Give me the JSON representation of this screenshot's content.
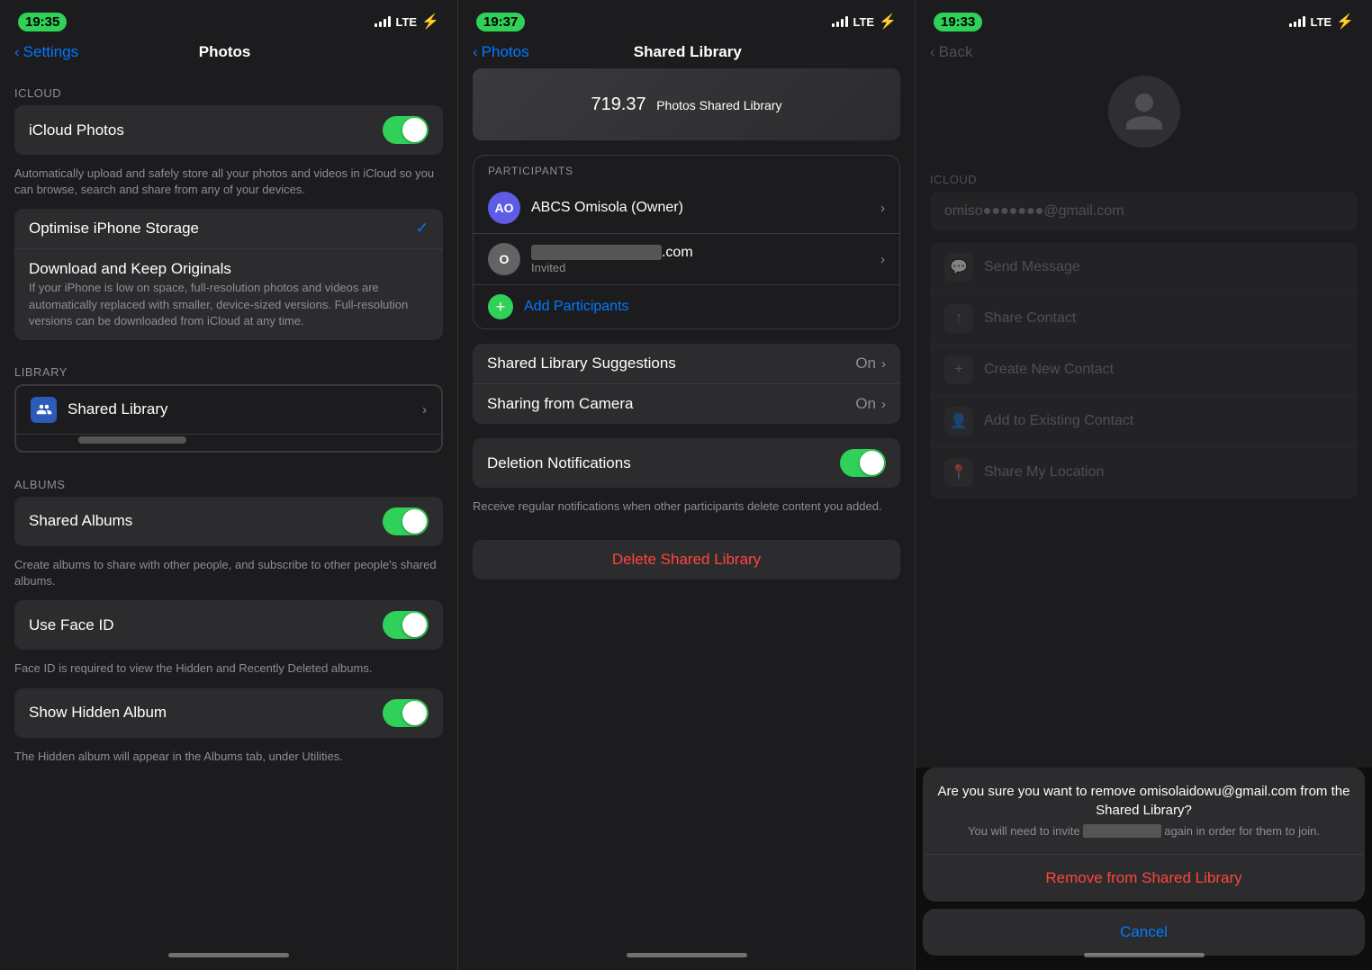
{
  "colors": {
    "green": "#30d158",
    "blue": "#007aff",
    "red": "#ff453a",
    "bg": "#1c1c1e",
    "card": "#2c2c2e",
    "separator": "#3a3a3c",
    "textPrimary": "#ffffff",
    "textSecondary": "#8e8e93"
  },
  "screen1": {
    "statusTime": "19:35",
    "navBack": "Settings",
    "navTitle": "Photos",
    "sections": {
      "icloud": {
        "header": "iCloud",
        "items": [
          {
            "label": "iCloud Photos",
            "toggle": true,
            "desc": "Automatically upload and safely store all your photos and videos in iCloud so you can browse, search and share from any of your devices."
          }
        ]
      },
      "storage": {
        "items": [
          {
            "label": "Optimise iPhone Storage",
            "checkmark": true
          },
          {
            "label": "Download and Keep Originals",
            "desc": "If your iPhone is low on space, full-resolution photos and videos are automatically replaced with smaller, device-sized versions. Full-resolution versions can be downloaded from iCloud at any time."
          }
        ]
      },
      "library": {
        "header": "Library",
        "items": [
          {
            "label": "Shared Library",
            "icon": "people",
            "highlighted": true,
            "chevron": true
          }
        ]
      },
      "albums": {
        "header": "Albums",
        "items": [
          {
            "label": "Shared Albums",
            "toggle": true,
            "desc": "Create albums to share with other people, and subscribe to other people's shared albums."
          },
          {
            "label": "Use Face ID",
            "toggle": true,
            "desc": "Face ID is required to view the Hidden and Recently Deleted albums."
          },
          {
            "label": "Show Hidden Album",
            "toggle": true,
            "desc": "The Hidden album will appear in the Albums tab, under Utilities."
          }
        ]
      }
    }
  },
  "screen2": {
    "statusTime": "19:37",
    "navBack": "Photos",
    "navTitle": "Shared Library",
    "headerPhotoCount": "719.37",
    "headerLabel": "Photos Shared Library",
    "popup": {
      "sectionHeader": "Participants",
      "participants": [
        {
          "initials": "AO",
          "name": "ABCS Omisola (Owner)",
          "sub": "",
          "avatarClass": "avatar-ao"
        },
        {
          "initials": "O",
          "name": "••••••••••••••.com",
          "sub": "Invited",
          "avatarClass": "avatar-o"
        }
      ],
      "addLabel": "Add Participants"
    },
    "settings": [
      {
        "label": "Shared Library Suggestions",
        "value": "On"
      },
      {
        "label": "Sharing from Camera",
        "value": "On"
      }
    ],
    "deletionNotifications": {
      "label": "Deletion Notifications",
      "toggle": true,
      "desc": "Receive regular notifications when other participants delete content you added."
    },
    "deleteButton": "Delete Shared Library"
  },
  "screen3": {
    "statusTime": "19:33",
    "navBack": "Back",
    "icloud": {
      "header": "iCloud",
      "email": "omiso●●●●●●●@gmail.com"
    },
    "actions": [
      "Send Message",
      "Share Contact",
      "Create New Contact",
      "Add to Existing Contact",
      "Share My Location"
    ],
    "actionSheet": {
      "title": "Are you sure you want to remove omisolaidowu@gmail.com from the Shared Library?",
      "subtitle": "You will need to invite ●●●●●●●●●●●●● again in order for them to join.",
      "destructiveBtn": "Remove from Shared Library",
      "cancelBtn": "Cancel"
    }
  }
}
